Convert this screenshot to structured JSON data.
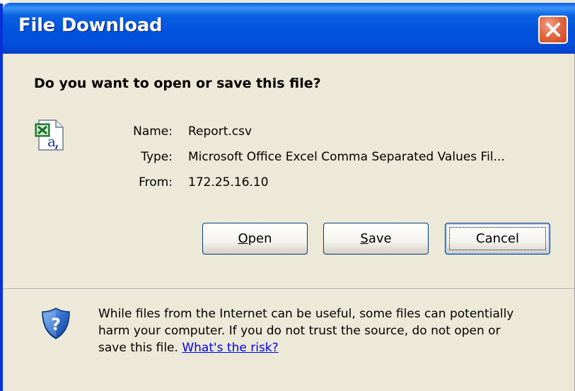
{
  "window": {
    "title": "File Download"
  },
  "dialog": {
    "question": "Do you want to open or save this file?",
    "file": {
      "name_label": "Name:",
      "name_value": "Report.csv",
      "type_label": "Type:",
      "type_value": "Microsoft Office Excel Comma Separated Values Fil...",
      "from_label": "From:",
      "from_value": "172.25.16.10"
    },
    "buttons": {
      "open_hotkey": "O",
      "open_rest": "pen",
      "save_hotkey": "S",
      "save_rest": "ave",
      "cancel_label": "Cancel"
    },
    "warning": {
      "line1": "While files from the Internet can be useful, some files can potentially",
      "line2": "harm your computer. If you do not trust the source, do not open or",
      "line3_prefix": "save this file. ",
      "link_text": "What's the risk?"
    }
  },
  "icons": {
    "file": "excel-csv-file-icon",
    "warning": "security-shield-icon",
    "close": "close-icon"
  },
  "colors": {
    "titlebar": "#0052dc",
    "dialog_background": "#ECE9D8",
    "close_button": "#e36a45",
    "link": "#0000ee"
  }
}
